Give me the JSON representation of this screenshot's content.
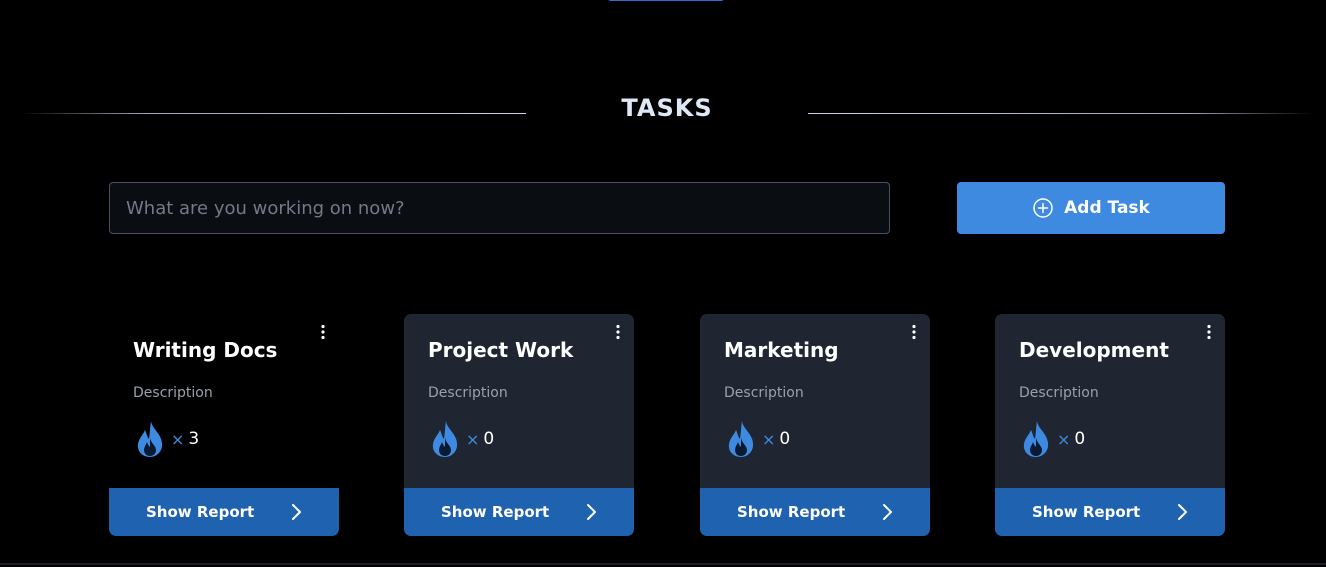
{
  "section": {
    "title": "TASKS"
  },
  "task_entry": {
    "placeholder": "What are you working on now?",
    "value": ""
  },
  "add_task_button": {
    "label": "Add Task",
    "icon": "plus-circle-icon"
  },
  "colors": {
    "accent": "#3d8ae0",
    "report_button": "#1f62b0",
    "card_background": "#1f2631",
    "page_background": "#000000"
  },
  "cards": [
    {
      "title": "Writing Docs",
      "description": "Description",
      "times_symbol": "×",
      "count": "3",
      "report_label": "Show Report",
      "selected": true
    },
    {
      "title": "Project Work",
      "description": "Description",
      "times_symbol": "×",
      "count": "0",
      "report_label": "Show Report",
      "selected": false
    },
    {
      "title": "Marketing",
      "description": "Description",
      "times_symbol": "×",
      "count": "0",
      "report_label": "Show Report",
      "selected": false
    },
    {
      "title": "Development",
      "description": "Description",
      "times_symbol": "×",
      "count": "0",
      "report_label": "Show Report",
      "selected": false
    }
  ]
}
